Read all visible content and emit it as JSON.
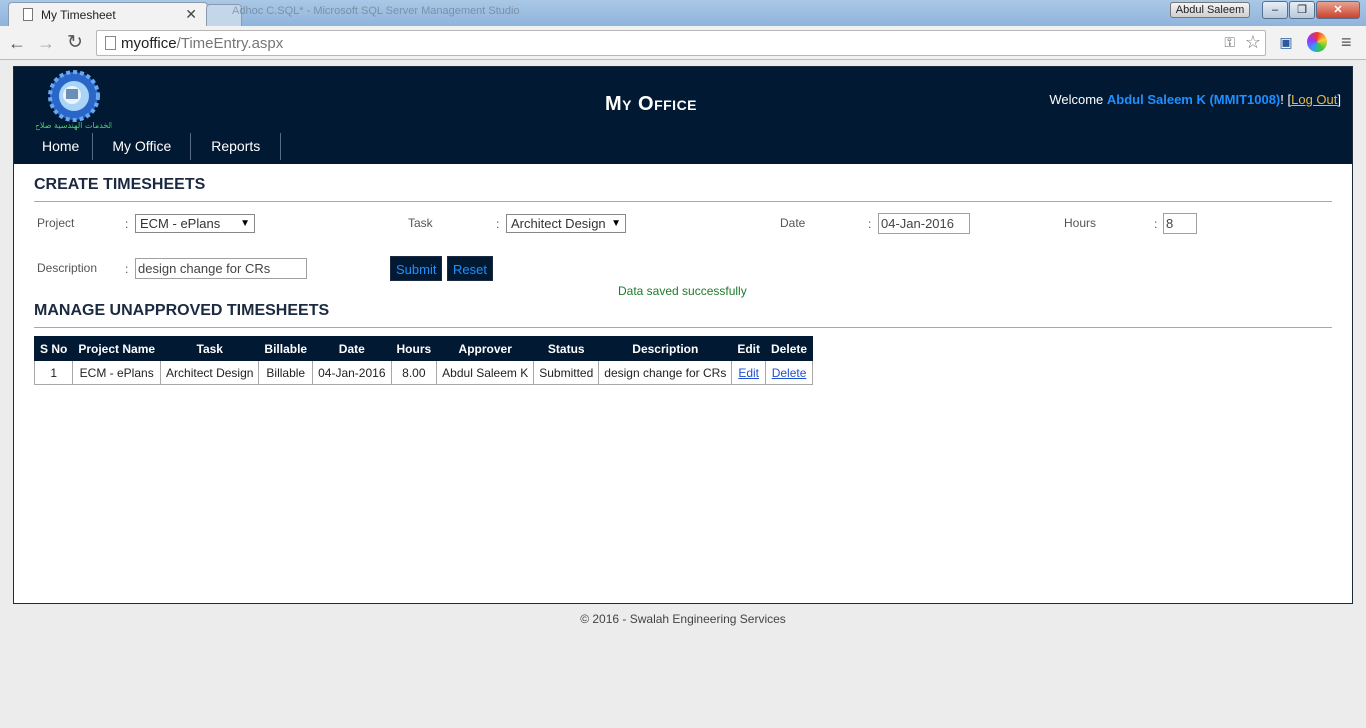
{
  "browser": {
    "tab_title": "My Timesheet",
    "tab_close": "✕",
    "background_window_title": "Adhoc C.SQL* - Microsoft SQL Server Management Studio",
    "user_chip": "Abdul Saleem",
    "url_host": "myoffice",
    "url_path": "/TimeEntry.aspx"
  },
  "site": {
    "title": "My Office",
    "welcome_prefix": "Welcome ",
    "user_name": "Abdul Saleem K (MMIT1008)",
    "welcome_suffix": "! [",
    "logout": "Log Out",
    "logout_close": "]",
    "logo_text": "الخدمات الهندسية صلاح",
    "nav": [
      "Home",
      "My Office",
      "Reports"
    ]
  },
  "create": {
    "section_title": "CREATE TIMESHEETS",
    "project_label": "Project",
    "project_value": "ECM - ePlans",
    "task_label": "Task",
    "task_value": "Architect Design",
    "date_label": "Date",
    "date_value": "04-Jan-2016",
    "hours_label": "Hours",
    "hours_value": "8",
    "description_label": "Description",
    "description_value": "design change for CRs",
    "submit_label": "Submit",
    "reset_label": "Reset",
    "success_message": "Data saved successfully",
    "colon": ":"
  },
  "manage": {
    "section_title": "MANAGE UNAPPROVED TIMESHEETS",
    "columns": [
      "S No",
      "Project Name",
      "Task",
      "Billable",
      "Date",
      "Hours",
      "Approver",
      "Status",
      "Description",
      "Edit",
      "Delete"
    ],
    "rows": [
      {
        "sno": "1",
        "project": "ECM - ePlans",
        "task": "Architect Design",
        "billable": "Billable",
        "date": "04-Jan-2016",
        "hours": "8.00",
        "approver": "Abdul Saleem K",
        "status": "Submitted",
        "description": "design change for CRs",
        "edit": "Edit",
        "delete": "Delete"
      }
    ]
  },
  "footer": "© 2016 - Swalah Engineering Services"
}
